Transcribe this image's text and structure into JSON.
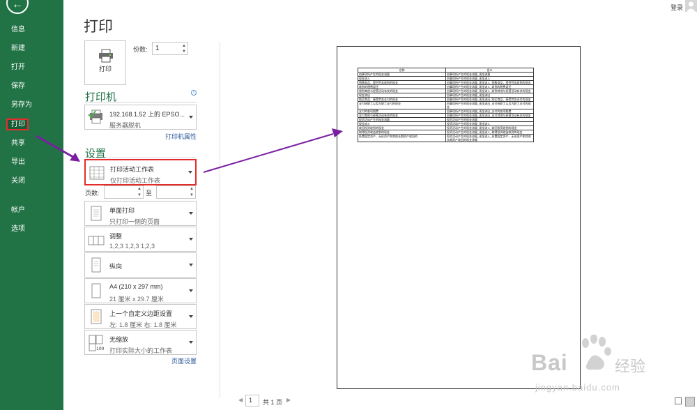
{
  "sidebar": {
    "items": [
      "信息",
      "新建",
      "打开",
      "保存",
      "另存为",
      "打印",
      "共享",
      "导出",
      "关闭",
      "帐户",
      "选项"
    ],
    "active": "打印"
  },
  "main": {
    "title": "打印",
    "print_button_label": "打印",
    "copies_label": "份数:",
    "copies_value": "1"
  },
  "printer": {
    "section_title": "打印机",
    "name": "192.168.1.52 上的 EPSO...",
    "status": "服务器脱机",
    "properties_link": "打印机属性"
  },
  "settings": {
    "section_title": "设置",
    "items": [
      {
        "title": "打印活动工作表",
        "subtitle": "仅打印活动工作表",
        "icon": "worksheet-icon"
      },
      {
        "title": "单面打印",
        "subtitle": "只打印一侧的页面",
        "icon": "one-sided-icon"
      },
      {
        "title": "调整",
        "subtitle": "1,2,3    1,2,3    1,2,3",
        "icon": "collate-icon"
      },
      {
        "title": "纵向",
        "subtitle": "",
        "icon": "portrait-icon"
      },
      {
        "title": "A4 (210 x 297 mm)",
        "subtitle": "21 厘米 x 29.7 厘米",
        "icon": "paper-size-icon"
      },
      {
        "title": "上一个自定义边距设置",
        "subtitle": "左: 1.8 厘米    右: 1.8 厘米",
        "icon": "margins-icon"
      },
      {
        "title": "无缩放",
        "subtitle": "打印实际大小的工作表",
        "icon": "scaling-icon"
      }
    ],
    "pages_label": "页数:",
    "to_label": "至",
    "page_setup_link": "页面设置"
  },
  "header": {
    "login": "登录"
  },
  "pager": {
    "current": "1",
    "total_text": "共 1 页"
  },
  "preview": {
    "headers": [
      "名称",
      "含义"
    ],
    "rows": [
      [
        "由事项所产生的现金流量",
        "由事项所产生的现金流量_现金流量"
      ],
      [
        "现金流入",
        "由事项所产生的现金流量_现金流入"
      ],
      [
        "销售商品、提供劳务收到的现金",
        "由事项所产生的现金流量_现金流入_销售商品、提供劳务收到的现金"
      ],
      [
        "收到的税费返还",
        "由事项所产生的现金流量_现金流入_收到的税费返还"
      ],
      [
        "收到其他与经营活动有关的现金",
        "由事项所产生的现金流量_现金流入_收到其他与经营活动有关的现金"
      ],
      [
        "现金流出",
        "由事项所产生的现金流量_现金流出"
      ],
      [
        "购买商品、接受劳务支付的现金",
        "由事项所产生的现金流量_现金流出_购买商品、接受劳务支付的现金"
      ],
      [
        "支付给职工以及为职工支付的现金",
        "由事项所产生的现金流量_现金流出_支付给职工以及为职工支付的现金"
      ],
      [
        "支付的各项税费",
        "由事项所产生的现金流量_现金流出_支付的各项税费"
      ],
      [
        "支付其他与经营活动有关的现金",
        "由事项所产生的现金流量_现金流出_支付其他与经营活动有关的现金"
      ],
      [
        "投资活动产生的现金流量",
        "投资活动产生的现金流量"
      ],
      [
        "现金流入",
        "投资活动产生的现金流量_现金流入"
      ],
      [
        "收回投资收到的现金",
        "投资活动产生的现金流量_现金流入_收回投资收到的现金"
      ],
      [
        "取得投资收益收到的现金",
        "投资活动产生的现金流量_现金流入_取得投资收益收到的现金"
      ],
      [
        "处置固定资产、无形资产和其他长期资产收回的",
        "投资活动产生的现金流量_现金流入_处置固定资产、无形资产和其他长期资产收回的现金净额"
      ]
    ]
  },
  "watermark": {
    "brand": "Bai",
    "brand2": "经验",
    "url": "jingyan.baidu.com"
  },
  "colors": {
    "sidebar": "#217346",
    "accent_green": "#217346",
    "highlight_red": "#e52c2c",
    "annotation_purple": "#7a1fa2",
    "link_blue": "#2b579a"
  }
}
